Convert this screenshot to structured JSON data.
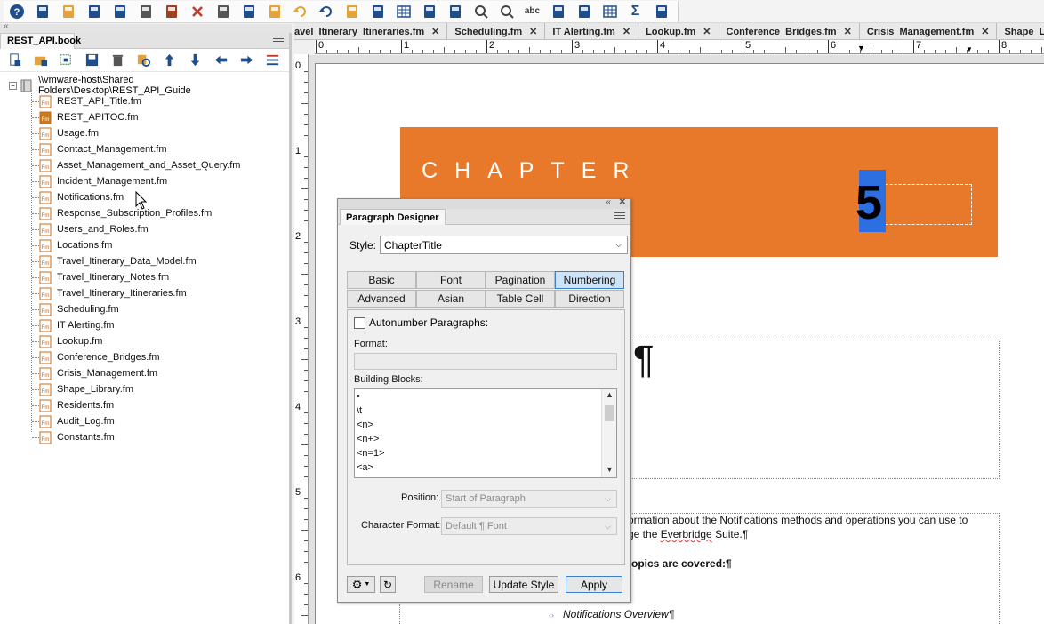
{
  "toolbar": {
    "icons": [
      "help-icon",
      "new-icon",
      "open-icon",
      "save-icon",
      "save-as-icon",
      "print-icon",
      "lock-icon",
      "delete-icon",
      "cut-icon",
      "copy-icon",
      "paste-icon",
      "undo-icon",
      "redo-icon",
      "import-icon",
      "update-icon",
      "table-icon",
      "insert-icon",
      "chart-icon",
      "zoom-in-icon",
      "zoom-out-icon",
      "spelling-icon",
      "anchor-icon",
      "text-frame-icon",
      "grid-icon",
      "sum-icon",
      "list-icon"
    ],
    "spell_label": "abc",
    "sum_label": "Σ"
  },
  "book_panel": {
    "tab_label": "REST_API.book",
    "root_path": "\\\\vmware-host\\Shared Folders\\Desktop\\REST_API_Guide",
    "files": [
      "REST_API_Title.fm",
      "REST_APITOC.fm",
      "Usage.fm",
      "Contact_Management.fm",
      "Asset_Management_and_Asset_Query.fm",
      "Incident_Management.fm",
      "Notifications.fm",
      "Response_Subscription_Profiles.fm",
      "Users_and_Roles.fm",
      "Locations.fm",
      "Travel_Itinerary_Data_Model.fm",
      "Travel_Itinerary_Notes.fm",
      "Travel_Itinerary_Itineraries.fm",
      "Scheduling.fm",
      "IT Alerting.fm",
      "Lookup.fm",
      "Conference_Bridges.fm",
      "Crisis_Management.fm",
      "Shape_Library.fm",
      "Residents.fm",
      "Audit_Log.fm",
      "Constants.fm"
    ]
  },
  "doc_tabs": [
    "avel_Itinerary_Itineraries.fm",
    "Scheduling.fm",
    "IT Alerting.fm",
    "Lookup.fm",
    "Conference_Bridges.fm",
    "Crisis_Management.fm",
    "Shape_L"
  ],
  "ruler": {
    "top_marks": [
      "0",
      "1",
      "2",
      "3",
      "4",
      "5",
      "6",
      "7",
      "8"
    ],
    "left_marks": [
      "0",
      "1",
      "2",
      "3",
      "4",
      "5",
      "6"
    ]
  },
  "page": {
    "chapter_word": "CHAPTER",
    "chapter_number": "5",
    "pilcrow": "¶",
    "intro_line1": "ormation about the Notifications methods and operations you can use to",
    "intro_line2_pre": "ge the ",
    "intro_line2_squiggle": "Everbridge",
    "intro_line2_post": " Suite.¶",
    "topics_heading": "topics are covered:¶",
    "toc_item": "Notifications Overview¶",
    "banner_color": "#e8792b"
  },
  "paragraph_designer": {
    "title": "Paragraph Designer",
    "style_label": "Style:",
    "style_value": "ChapterTitle",
    "tabs": [
      "Basic",
      "Font",
      "Pagination",
      "Numbering",
      "Advanced",
      "Asian",
      "Table Cell",
      "Direction"
    ],
    "active_tab": "Numbering",
    "autonumber_label": "Autonumber Paragraphs:",
    "format_label": "Format:",
    "format_value": "",
    "building_blocks_label": "Building Blocks:",
    "building_blocks": [
      "•",
      "\\t",
      "<n>",
      "<n+>",
      "<n=1>",
      "<a>"
    ],
    "position_label": "Position:",
    "position_value": "Start of Paragraph",
    "char_format_label": "Character Format:",
    "char_format_value": "Default ¶ Font",
    "rename_label": "Rename",
    "update_style_label": "Update Style",
    "apply_label": "Apply"
  }
}
